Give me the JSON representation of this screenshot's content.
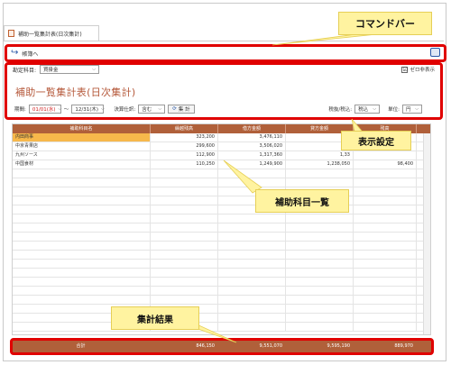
{
  "window": {
    "tab_label": "補助一覧集計表(日次集計)"
  },
  "command_bar": {
    "back_label": "帳簿へ"
  },
  "settings": {
    "account_label": "勘定科目:",
    "account_value": "買掛金",
    "hide_zero_label": "ゼロ非表示",
    "hide_zero_checked": "☑",
    "title": "補助一覧集計表(日次集計)",
    "period_label": "期間:",
    "period_from": "01/01(水)",
    "period_sep": "〜",
    "period_to": "12/31(木)",
    "closing_label": "決算仕訳:",
    "closing_value": "含む",
    "aggregate_label": "集 計",
    "tax_label": "税抜/税込:",
    "tax_value": "税込",
    "unit_label": "単位:",
    "unit_value": "円"
  },
  "grid": {
    "headers": [
      "補助科目名",
      "繰越残高",
      "借方金額",
      "貸方金額",
      "残高"
    ],
    "rows": [
      [
        "内田商事",
        "323,200",
        "3,476,110",
        "3,4",
        ""
      ],
      [
        "中京青果店",
        "299,600",
        "3,506,020",
        "3,5",
        ""
      ],
      [
        "九州ソース",
        "112,900",
        "1,317,360",
        "1,33",
        ""
      ],
      [
        "中国食材",
        "110,250",
        "1,249,900",
        "1,238,050",
        "98,400"
      ]
    ]
  },
  "totals": {
    "label": "合計",
    "values": [
      "846,150",
      "9,551,070",
      "9,595,190",
      "889,970"
    ]
  },
  "callouts": {
    "command_bar": "コマンドバー",
    "display_settings": "表示設定",
    "sub_account_list": "補助科目一覧",
    "aggregate_result": "集計結果"
  },
  "colors": {
    "accent": "#b0603a",
    "highlight": "#e00000",
    "callout_bg": "#fff3a0",
    "selected_row": "#f7b84b"
  }
}
